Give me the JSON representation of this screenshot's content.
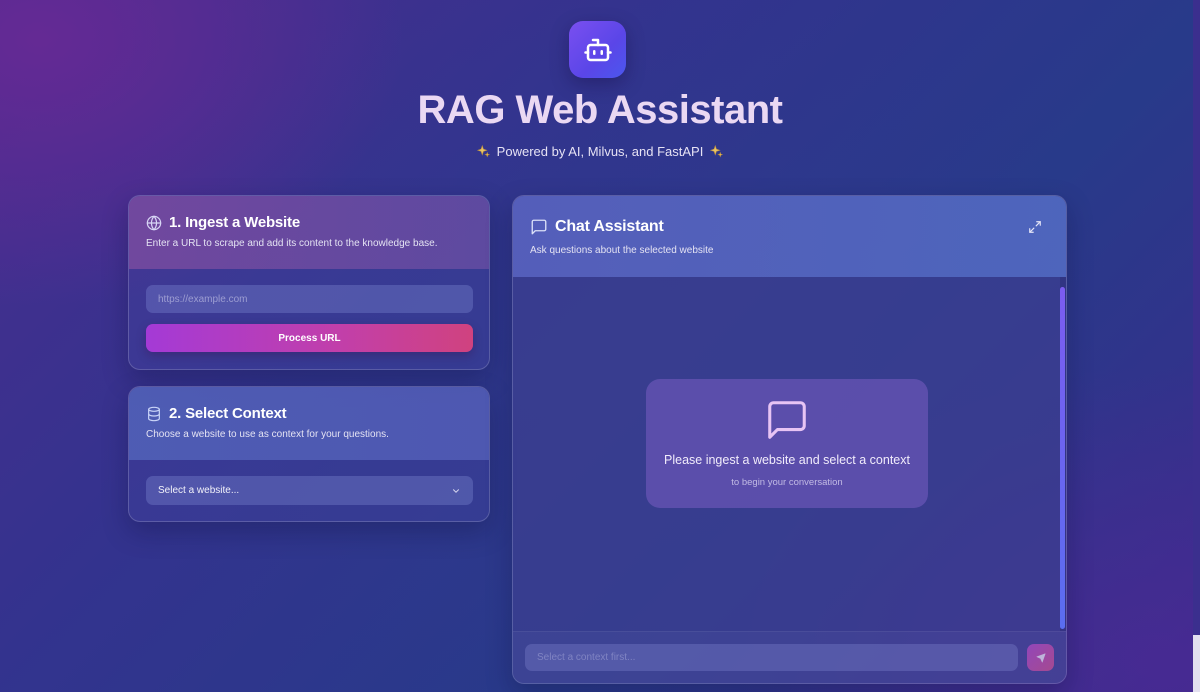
{
  "header": {
    "logo_icon": "robot-icon",
    "title": "RAG Web Assistant",
    "subtitle": "Powered by AI, Milvus, and FastAPI",
    "sparkle_icon": "sparkles-icon"
  },
  "ingest": {
    "icon": "globe-icon",
    "title": "1. Ingest a Website",
    "description": "Enter a URL to scrape and add its content to the knowledge base.",
    "url_placeholder": "https://example.com",
    "url_value": "",
    "button_label": "Process URL"
  },
  "context": {
    "icon": "database-icon",
    "title": "2. Select Context",
    "description": "Choose a website to use as context for your questions.",
    "select_value": "Select a website..."
  },
  "chat": {
    "icon": "message-square-icon",
    "title": "Chat Assistant",
    "description": "Ask questions about the selected website",
    "expand_icon": "maximize-icon",
    "empty_title": "Please ingest a website and select a context",
    "empty_subtitle": "to begin your conversation",
    "input_placeholder": "Select a context first...",
    "send_icon": "send-icon"
  },
  "colors": {
    "accent_start": "#a43ad6",
    "accent_end": "#d0427f",
    "logo": "#6a4cf0"
  }
}
